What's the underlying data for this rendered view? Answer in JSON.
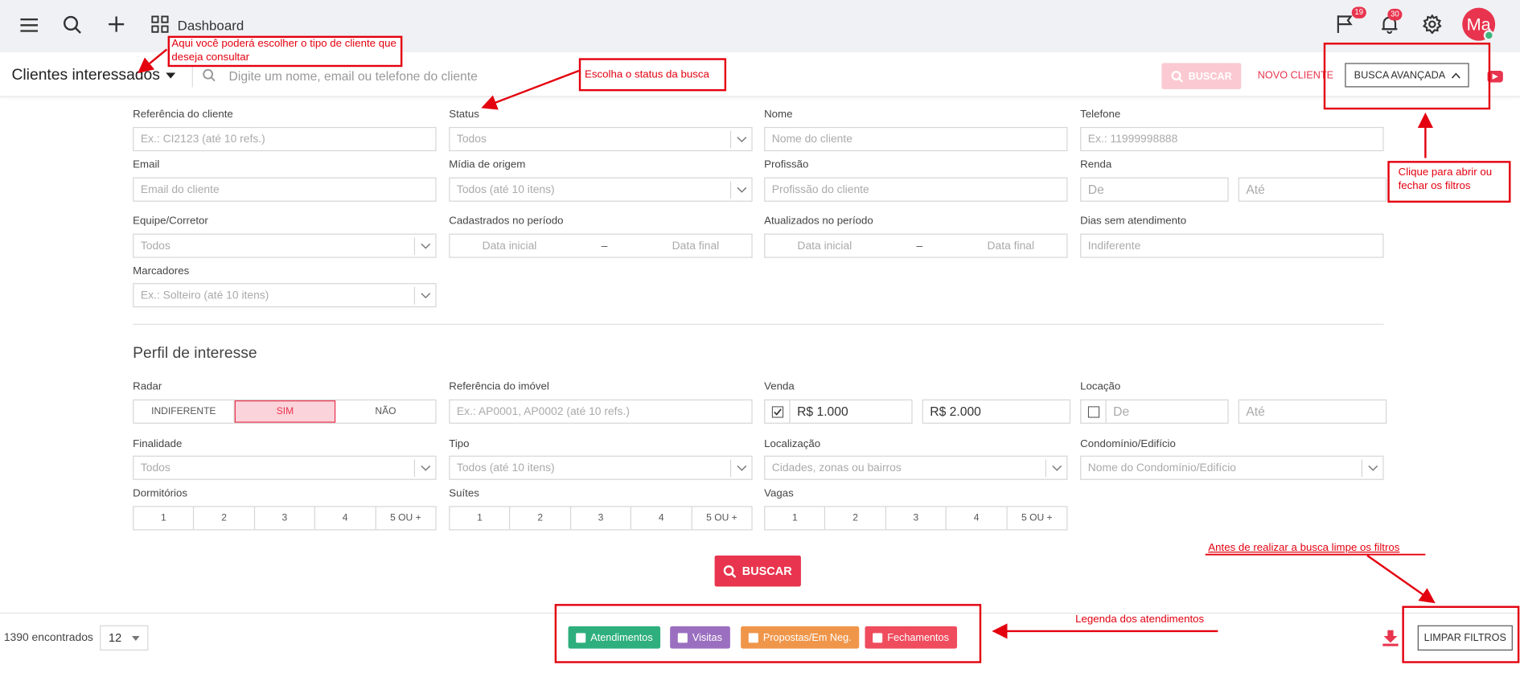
{
  "topbar": {
    "dashboard_label": "Dashboard",
    "flag_count": "19",
    "notif_count": "30",
    "avatar_initials": "Ma"
  },
  "subbar": {
    "page_title": "Clientes interessados",
    "search_placeholder": "Digite um nome, email ou telefone do cliente",
    "buscar_label": "BUSCAR",
    "novo_cliente_label": "NOVO CLIENTE",
    "busca_avancada_label": "BUSCA AVANÇADA"
  },
  "filters": {
    "ref_cliente": {
      "label": "Referência do cliente",
      "placeholder": "Ex.: CI2123 (até 10 refs.)"
    },
    "status": {
      "label": "Status",
      "value": "Todos"
    },
    "nome": {
      "label": "Nome",
      "placeholder": "Nome do cliente"
    },
    "telefone": {
      "label": "Telefone",
      "placeholder": "Ex.: 11999998888"
    },
    "email": {
      "label": "Email",
      "placeholder": "Email do cliente"
    },
    "midia": {
      "label": "Mídia de origem",
      "value": "Todos (até 10 itens)"
    },
    "profissao": {
      "label": "Profissão",
      "placeholder": "Profissão do cliente"
    },
    "renda": {
      "label": "Renda",
      "from": "De",
      "to": "Até"
    },
    "equipe": {
      "label": "Equipe/Corretor",
      "value": "Todos"
    },
    "cadastrados": {
      "label": "Cadastrados no período",
      "start": "Data inicial",
      "sep": "–",
      "end": "Data final"
    },
    "atualizados": {
      "label": "Atualizados no período",
      "start": "Data inicial",
      "sep": "–",
      "end": "Data final"
    },
    "dias": {
      "label": "Dias sem atendimento",
      "value": "Indiferente"
    },
    "marcadores": {
      "label": "Marcadores",
      "value": "Ex.: Solteiro (até 10 itens)"
    }
  },
  "perfil": {
    "title": "Perfil de interesse",
    "radar": {
      "label": "Radar",
      "options": [
        "INDIFERENTE",
        "SIM",
        "NÃO"
      ],
      "selected": "SIM"
    },
    "ref_imovel": {
      "label": "Referência do imóvel",
      "placeholder": "Ex.: AP0001, AP0002 (até 10 refs.)"
    },
    "venda": {
      "label": "Venda",
      "min": "R$ 1.000",
      "max": "R$ 2.000",
      "checked": true
    },
    "locacao": {
      "label": "Locação",
      "from": "De",
      "to": "Até",
      "checked": false
    },
    "finalidade": {
      "label": "Finalidade",
      "value": "Todos"
    },
    "tipo": {
      "label": "Tipo",
      "value": "Todos (até 10 itens)"
    },
    "localizacao": {
      "label": "Localização",
      "value": "Cidades, zonas ou bairros"
    },
    "condominio": {
      "label": "Condomínio/Edifício",
      "value": "Nome do Condomínio/Edifício"
    },
    "dormitorios": {
      "label": "Dormitórios",
      "options": [
        "1",
        "2",
        "3",
        "4",
        "5 OU +"
      ]
    },
    "suites": {
      "label": "Suítes",
      "options": [
        "1",
        "2",
        "3",
        "4",
        "5 OU +"
      ]
    },
    "vagas": {
      "label": "Vagas",
      "options": [
        "1",
        "2",
        "3",
        "4",
        "5 OU +"
      ]
    }
  },
  "buscar_main": "BUSCAR",
  "footer": {
    "count_text": "1390 encontrados",
    "per_page": "12",
    "limpar_label": "LIMPAR FILTROS",
    "legend": [
      {
        "label": "Atendimentos",
        "color": "#2eaf7d"
      },
      {
        "label": "Visitas",
        "color": "#9b6fc0"
      },
      {
        "label": "Propostas/Em Neg.",
        "color": "#f0964a"
      },
      {
        "label": "Fechamentos",
        "color": "#ef4c5d"
      }
    ]
  },
  "annotations": {
    "tipo_cliente": "Aqui você poderá escolher o tipo de cliente que deseja consultar",
    "status": "Escolha o status da busca",
    "filtros": "Clique para abrir ou fechar os filtros",
    "limpe": "Antes de realizar a busca limpe os filtros",
    "legenda": "Legenda dos atendimentos"
  },
  "colors": {
    "accent": "#e8344e",
    "annotation": "#e3000f"
  }
}
